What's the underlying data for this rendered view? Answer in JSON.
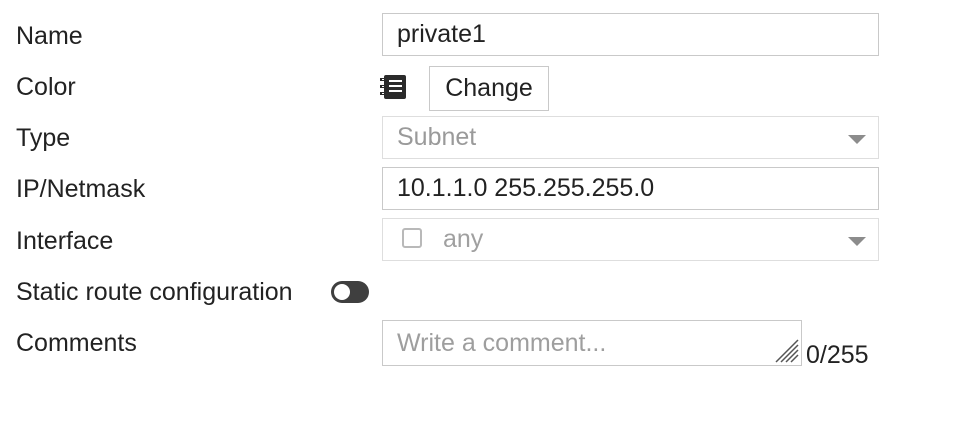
{
  "form": {
    "name": {
      "label": "Name",
      "value": "private1"
    },
    "color": {
      "label": "Color",
      "icon": "color-swatch-icon",
      "change_label": "Change"
    },
    "type": {
      "label": "Type",
      "value": "Subnet",
      "icon": "chevron-down-icon"
    },
    "ip_netmask": {
      "label": "IP/Netmask",
      "value": "10.1.1.0 255.255.255.0"
    },
    "interface": {
      "label": "Interface",
      "value": "any",
      "checked": false,
      "icon": "chevron-down-icon"
    },
    "static_route": {
      "label": "Static route configuration",
      "enabled": false
    },
    "comments": {
      "label": "Comments",
      "placeholder": "Write a comment...",
      "counter": "0/255"
    }
  },
  "colors": {
    "border": "#c9c9c9",
    "disabled_text": "#9a9a9a",
    "toggle_off": "#3f3f3f",
    "text": "#222222"
  }
}
